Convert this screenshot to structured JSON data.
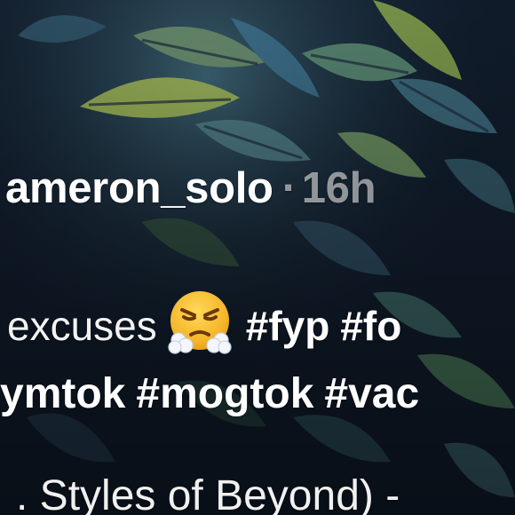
{
  "post": {
    "username": "ameron_solo",
    "separator": "·",
    "time_ago": "16h"
  },
  "caption": {
    "line1_text": "excuses",
    "emoji": "steam-from-nose-face-emoji",
    "line1_hashtags": [
      "#fyp",
      "#fo"
    ],
    "line2_hashtags": [
      "ymtok",
      "#mogtok",
      "#vac"
    ]
  },
  "music": {
    "text": ". Styles of Beyond) -"
  }
}
